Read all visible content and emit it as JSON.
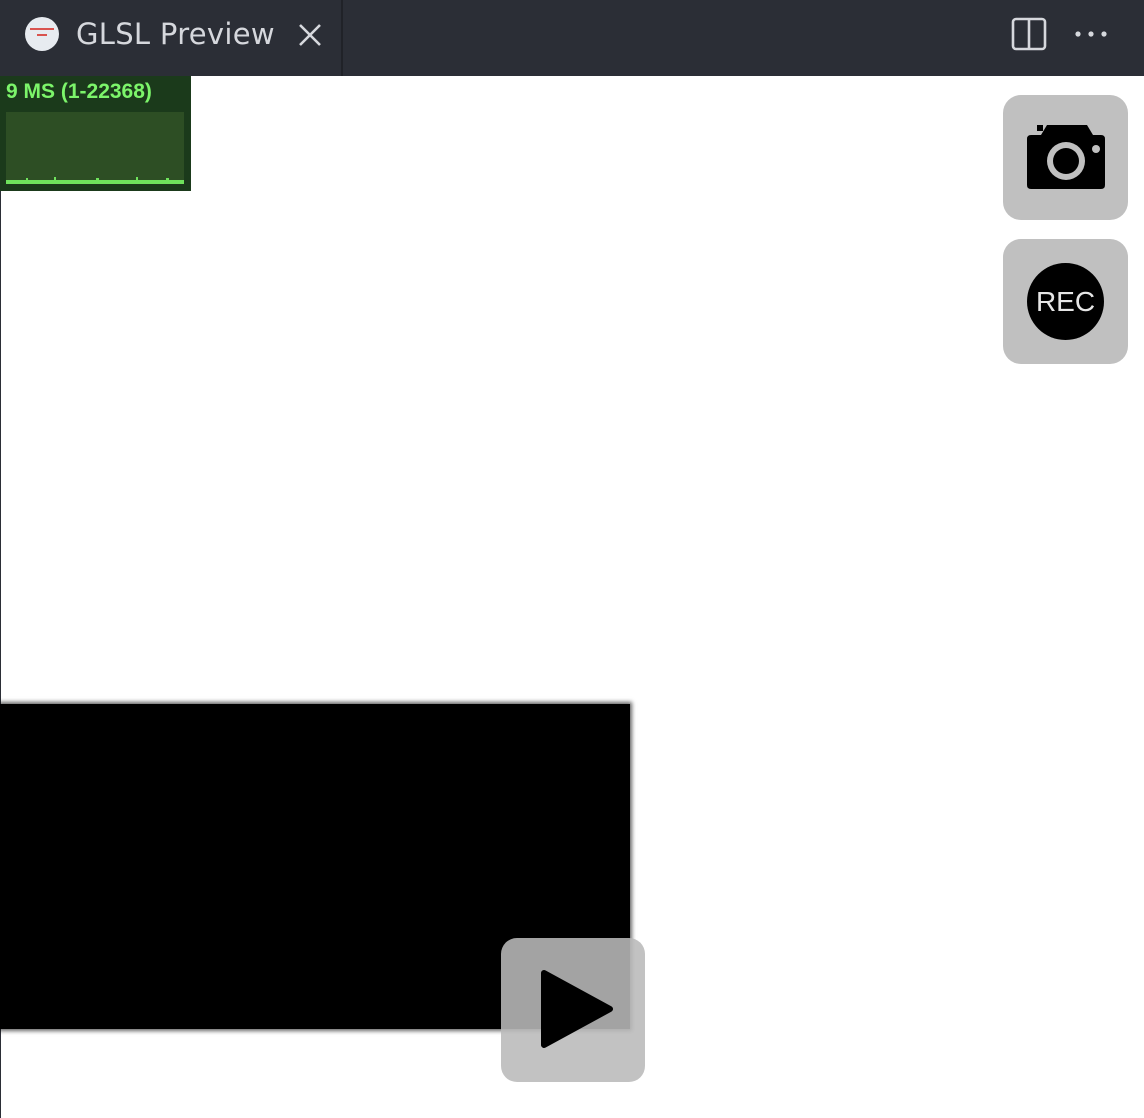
{
  "tab": {
    "title": "GLSL Preview",
    "icon": "shader-toy-logo-icon"
  },
  "toolbar": {
    "split_icon": "split-editor-icon",
    "more_icon": "more-actions-icon"
  },
  "stats": {
    "label": "9 MS (1-22368)"
  },
  "controls": {
    "screenshot_icon": "camera-icon",
    "record_label": "REC",
    "play_icon": "play-icon"
  },
  "colors": {
    "tabbar_bg": "#2b2e36",
    "stats_text": "#7cf56a",
    "stats_bg": "#1b3a1b",
    "control_bg": "#c0c0c0"
  }
}
